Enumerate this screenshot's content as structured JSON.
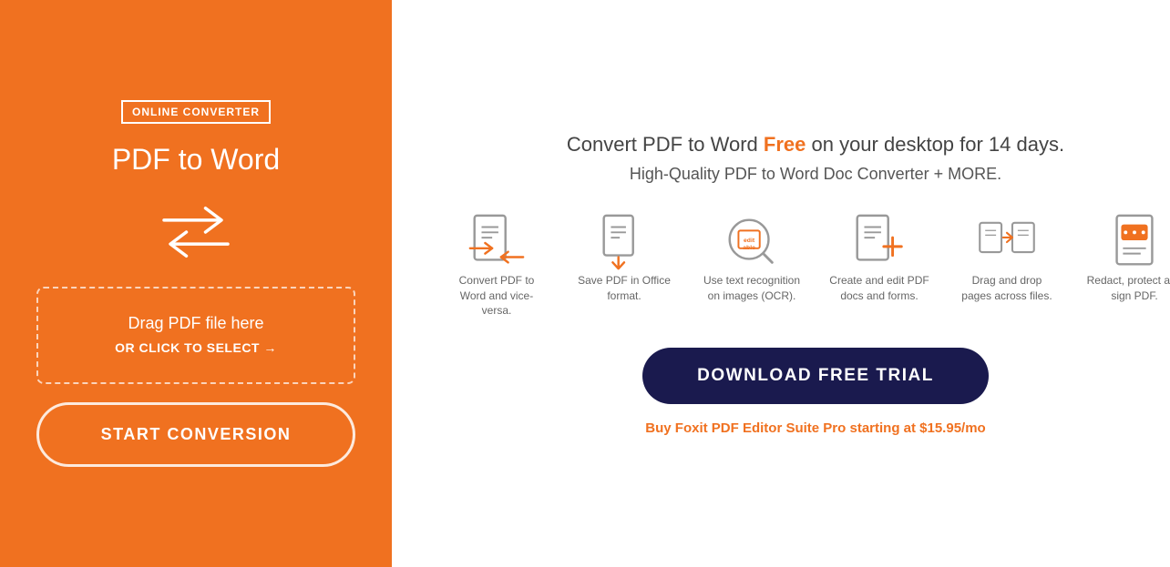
{
  "left": {
    "badge": "ONLINE CONVERTER",
    "title": "PDF to Word",
    "drop_text": "Drag PDF file here",
    "drop_select": "OR CLICK TO SELECT  →",
    "start_button": "START CONVERSION"
  },
  "right": {
    "headline_part1": "Convert PDF to Word ",
    "headline_free": "Free",
    "headline_part2": " on your desktop for 14 days.",
    "subheadline": "High-Quality PDF to Word Doc Converter + MORE.",
    "download_button": "DOWNLOAD FREE TRIAL",
    "buy_link": "Buy Foxit PDF Editor Suite Pro starting at $15.95/mo",
    "features": [
      {
        "id": "convert",
        "label": "Convert PDF to Word and vice-versa."
      },
      {
        "id": "save",
        "label": "Save PDF in Office format."
      },
      {
        "id": "ocr",
        "label": "Use text recognition on images (OCR)."
      },
      {
        "id": "edit",
        "label": "Create and edit PDF docs and forms."
      },
      {
        "id": "drag",
        "label": "Drag and drop pages across files."
      },
      {
        "id": "redact",
        "label": "Redact, protect and sign PDF."
      }
    ]
  }
}
